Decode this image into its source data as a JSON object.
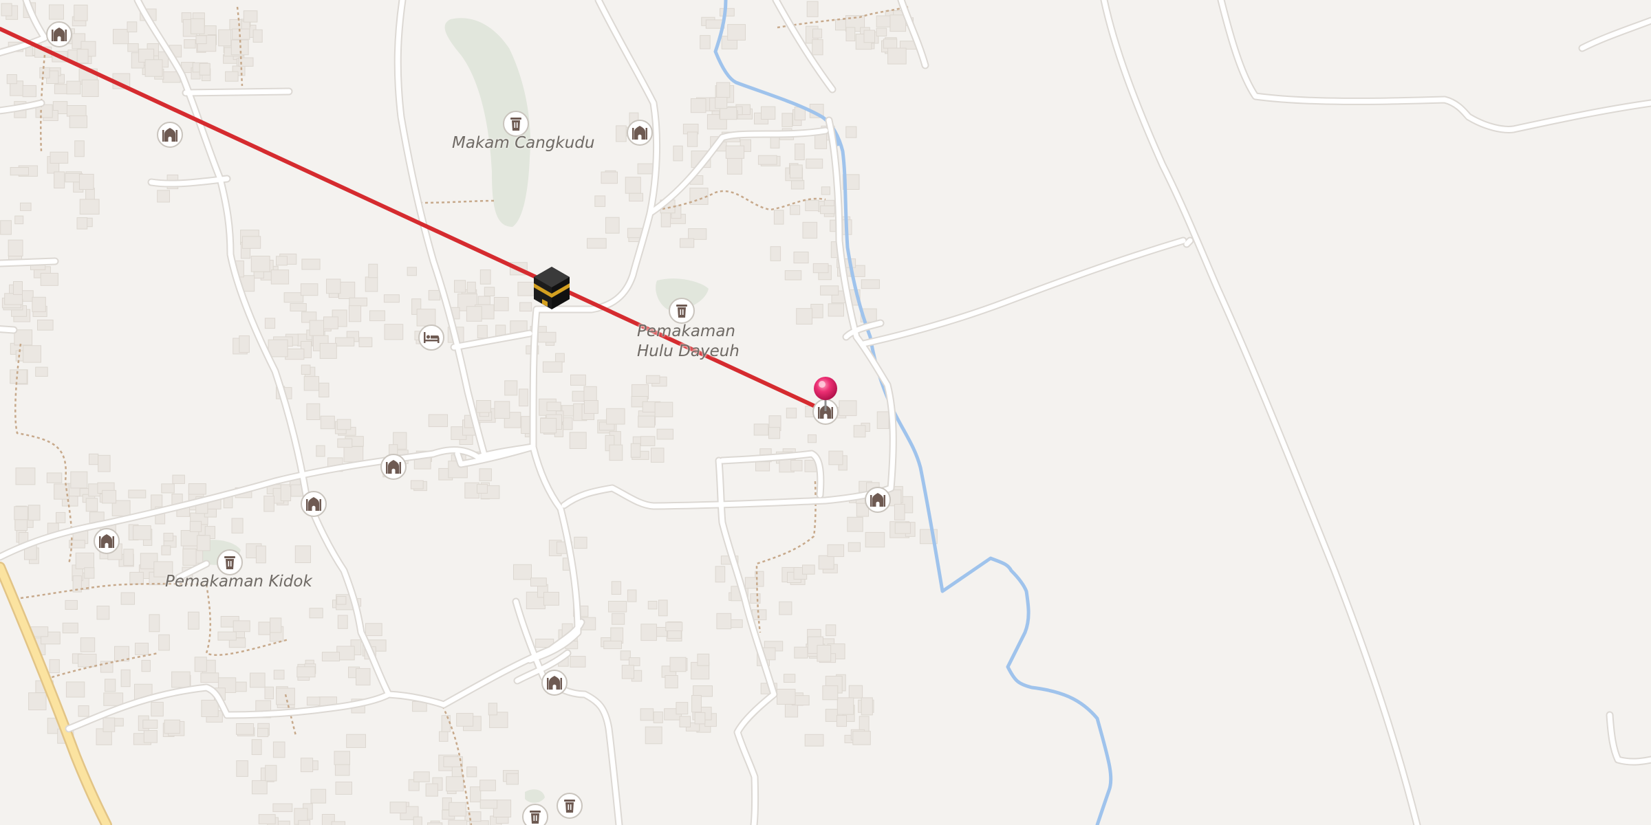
{
  "map": {
    "colors": {
      "background": "#f4f2ef",
      "road": "#ffffff",
      "road_casing": "#dcd8d3",
      "main_road": "#fbe3a0",
      "main_road_casing": "#e2c486",
      "river": "#9fc3ec",
      "building": "#ebe7e2",
      "building_outline": "#dcd7d0",
      "cemetery": "#e1e6dc",
      "path": "#c7a98b",
      "qibla_line": "#d52b2f",
      "pin": "#e8256a",
      "poi_icon": "#6e5a52"
    },
    "labels": {
      "makam_cangkudu": "Makam Cangkudu",
      "pemakaman_hulu_1": "Pemakaman",
      "pemakaman_hulu_2": "Hulu Dayeuh",
      "pemakaman_kidok": "Pemakaman Kidok"
    },
    "markers": {
      "kaaba": "kaaba-icon",
      "location_pin": "location-pin-icon"
    },
    "pois": [
      {
        "type": "mosque-icon"
      },
      {
        "type": "mosque-icon"
      },
      {
        "type": "mosque-icon"
      },
      {
        "type": "mosque-icon"
      },
      {
        "type": "mosque-icon"
      },
      {
        "type": "mosque-icon"
      },
      {
        "type": "mosque-icon"
      },
      {
        "type": "mosque-icon"
      },
      {
        "type": "mosque-icon"
      },
      {
        "type": "cemetery-icon"
      },
      {
        "type": "cemetery-icon"
      },
      {
        "type": "cemetery-icon"
      },
      {
        "type": "cemetery-icon"
      },
      {
        "type": "cemetery-icon"
      },
      {
        "type": "hotel-icon"
      }
    ]
  }
}
